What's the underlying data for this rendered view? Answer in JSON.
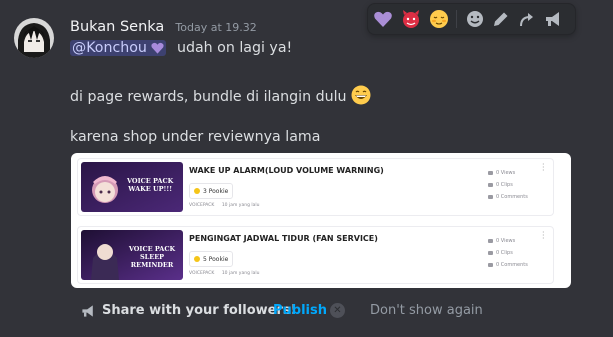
{
  "message": {
    "username": "Bukan Senka",
    "timestamp": "Today at 19.32",
    "mention": "@Konchou",
    "line1_text": "udah on lagi ya!",
    "line2_text": "di page rewards, bundle di ilangin dulu",
    "line3_text": "karena shop under reviewnya lama"
  },
  "toolbar": {
    "icons": [
      "purple-heart",
      "devil-face",
      "relieved-face",
      "add-reaction",
      "edit",
      "reply",
      "announce"
    ]
  },
  "embed": {
    "items": [
      {
        "title": "WAKE UP ALARM(LOUD VOLUME WARNING)",
        "price": "3 Pookie",
        "category": "VOICEPACK",
        "time": "10 jam yang lalu",
        "views": "0 Views",
        "clips": "0 Clips",
        "comments": "0 Comments",
        "thumb_line1": "VOICE PACK",
        "thumb_line2": "WAKE UP!!!"
      },
      {
        "title": "PENGINGAT JADWAL TIDUR (FAN SERVICE)",
        "price": "5 Pookie",
        "category": "VOICEPACK",
        "time": "10 jam yang lalu",
        "views": "0 Views",
        "clips": "0 Clips",
        "comments": "0 Comments",
        "thumb_line1": "VOICE PACK",
        "thumb_line2": "SLEEP REMINDER"
      }
    ]
  },
  "share_bar": {
    "label": "Share with your followers!",
    "publish": "Publish",
    "dont_show": "Don't show again"
  },
  "colors": {
    "background": "#323339",
    "mention_bg": "#4b4f8c",
    "link": "#00a8fc"
  }
}
